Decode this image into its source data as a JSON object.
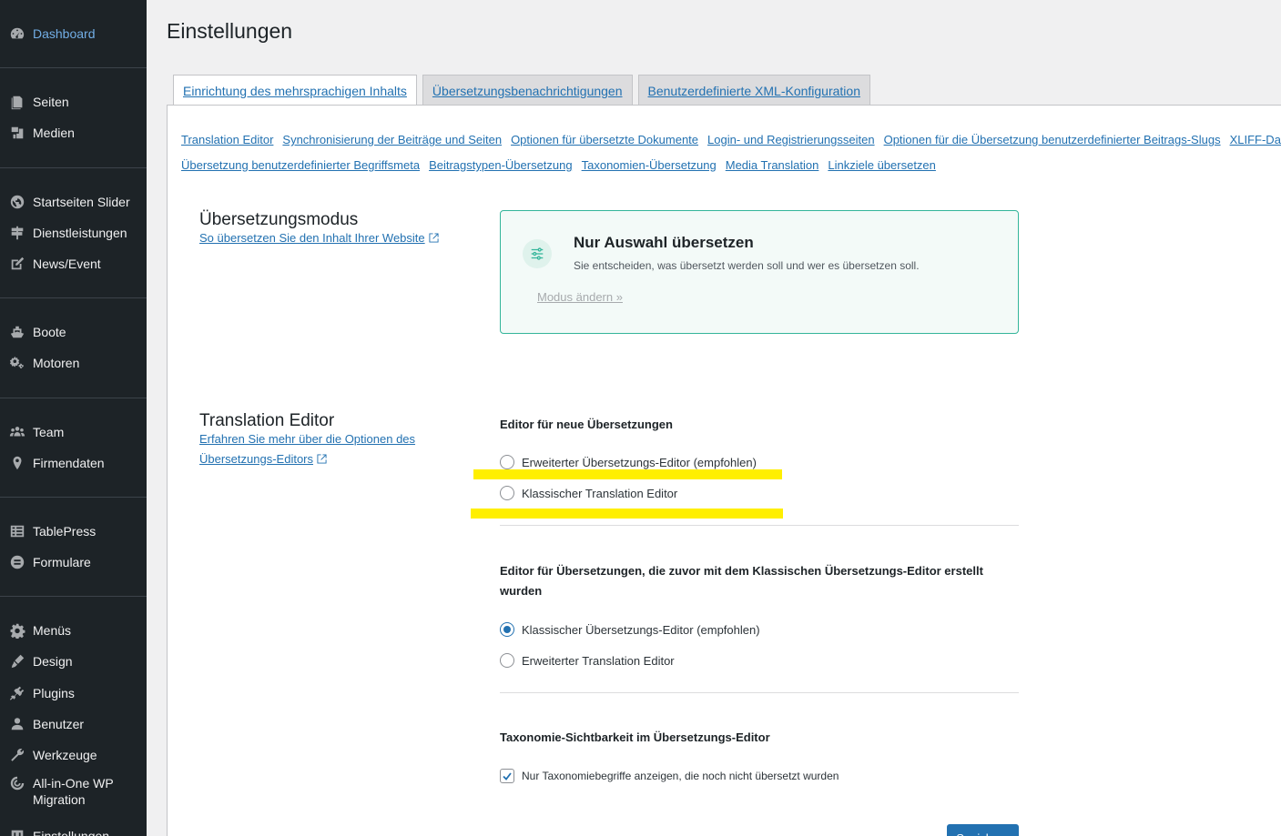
{
  "sidebar": {
    "items": [
      {
        "label": "Dashboard",
        "icon": "dashboard-icon"
      },
      {
        "label": "Seiten",
        "icon": "pages-icon"
      },
      {
        "label": "Medien",
        "icon": "media-icon"
      },
      {
        "label": "Startseiten Slider",
        "icon": "globe-icon"
      },
      {
        "label": "Dienstleistungen",
        "icon": "signpost-icon"
      },
      {
        "label": "News/Event",
        "icon": "edit-icon"
      },
      {
        "label": "Boote",
        "icon": "ship-icon"
      },
      {
        "label": "Motoren",
        "icon": "gears-icon"
      },
      {
        "label": "Team",
        "icon": "groups-icon"
      },
      {
        "label": "Firmendaten",
        "icon": "location-icon"
      },
      {
        "label": "TablePress",
        "icon": "table-icon"
      },
      {
        "label": "Formulare",
        "icon": "forms-icon"
      },
      {
        "label": "Menüs",
        "icon": "gear-icon"
      },
      {
        "label": "Design",
        "icon": "brush-icon"
      },
      {
        "label": "Plugins",
        "icon": "plugin-icon"
      },
      {
        "label": "Benutzer",
        "icon": "user-icon"
      },
      {
        "label": "Werkzeuge",
        "icon": "wrench-icon"
      },
      {
        "label": "All-in-One WP Migration",
        "icon": "migration-icon"
      },
      {
        "label": "Einstellungen",
        "icon": "settings-icon"
      }
    ]
  },
  "page": {
    "title": "Einstellungen"
  },
  "tabs": [
    {
      "label": "Einrichtung des mehrsprachigen Inhalts"
    },
    {
      "label": "Übersetzungsbenachrichtigungen"
    },
    {
      "label": "Benutzerdefinierte XML-Konfiguration"
    }
  ],
  "sublinks_row1": [
    "Translation Editor",
    "Synchronisierung der Beiträge und Seiten",
    "Optionen für übersetzte Dokumente",
    "Login- und Registrierungsseiten",
    "Optionen für die Übersetzung benutzerdefinierter Beitrags-Slugs",
    "XLIFF-Date"
  ],
  "sublinks_row2": [
    "Übersetzung benutzerdefinierter Begriffsmeta",
    "Beitragstypen-Übersetzung",
    "Taxonomien-Übersetzung",
    "Media Translation",
    "Linkziele übersetzen"
  ],
  "mode_section": {
    "title": "Übersetzungsmodus",
    "help_link": "So übersetzen Sie den Inhalt Ihrer Website",
    "box_title": "Nur Auswahl übersetzen",
    "box_desc": "Sie entscheiden, was übersetzt werden soll und wer es übersetzen soll.",
    "change_link": "Modus ändern »"
  },
  "editor_section": {
    "title": "Translation Editor",
    "help_link_line1": "Erfahren Sie mehr über die Optionen des",
    "help_link_line2": "Übersetzungs-Editors",
    "new_heading": "Editor für neue Übersetzungen",
    "new_opt1": "Erweiterter Übersetzungs-Editor (empfohlen)",
    "new_opt2": "Klassischer Translation Editor",
    "old_heading": "Editor für Übersetzungen, die zuvor mit dem Klassischen Übersetzungs-Editor erstellt wurden",
    "old_opt1": "Klassischer Übersetzungs-Editor (empfohlen)",
    "old_opt2": "Erweiterter Translation Editor",
    "tax_heading": "Taxonomie-Sichtbarkeit im Übersetzungs-Editor",
    "tax_checkbox": "Nur Taxonomiebegriffe anzeigen, die noch nicht übersetzt wurden",
    "save_label": "Speichern"
  },
  "colors": {
    "accent": "#2271b1",
    "highlight": "#ffef00",
    "sidebar": "#1d2327",
    "mode_border": "#33b59a"
  }
}
